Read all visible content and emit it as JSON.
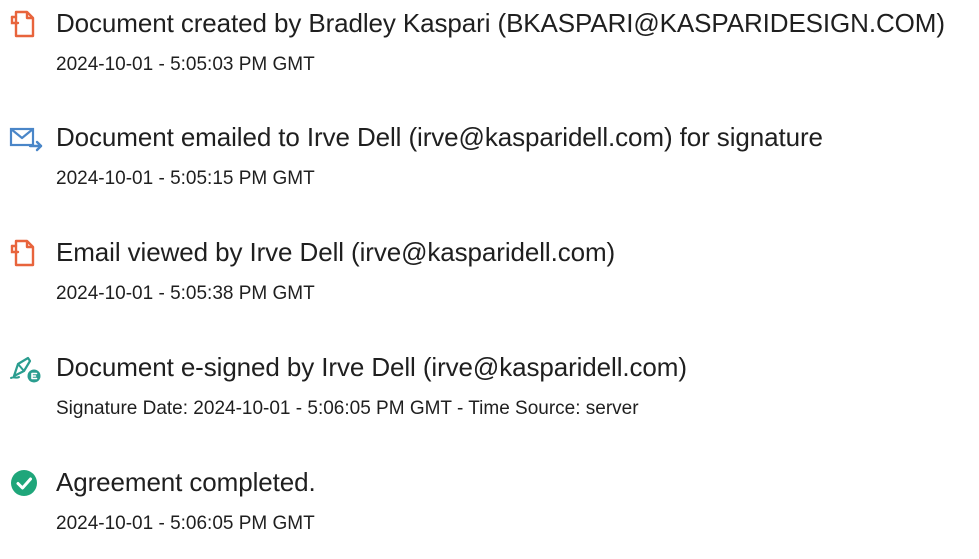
{
  "events": [
    {
      "icon": "document-icon",
      "title": "Document created by Bradley Kaspari (BKASPARI@KASPARIDESIGN.COM)",
      "detail": "2024-10-01 - 5:05:03 PM GMT"
    },
    {
      "icon": "email-send-icon",
      "title": "Document emailed to Irve Dell (irve@kasparidell.com) for signature",
      "detail": "2024-10-01 - 5:05:15 PM GMT"
    },
    {
      "icon": "document-icon",
      "title": "Email viewed by Irve Dell (irve@kasparidell.com)",
      "detail": "2024-10-01 - 5:05:38 PM GMT"
    },
    {
      "icon": "esign-pen-icon",
      "title": "Document e-signed by Irve Dell (irve@kasparidell.com)",
      "detail": "Signature Date: 2024-10-01 - 5:06:05 PM GMT - Time Source: server"
    },
    {
      "icon": "check-circle-icon",
      "title": "Agreement completed.",
      "detail": "2024-10-01 - 5:06:05 PM GMT"
    }
  ],
  "colors": {
    "document_icon": "#e8643c",
    "email_icon": "#4a86c8",
    "esign_icon": "#2a9d8f",
    "complete_icon": "#1fa67a",
    "text": "#1f1f1f"
  }
}
